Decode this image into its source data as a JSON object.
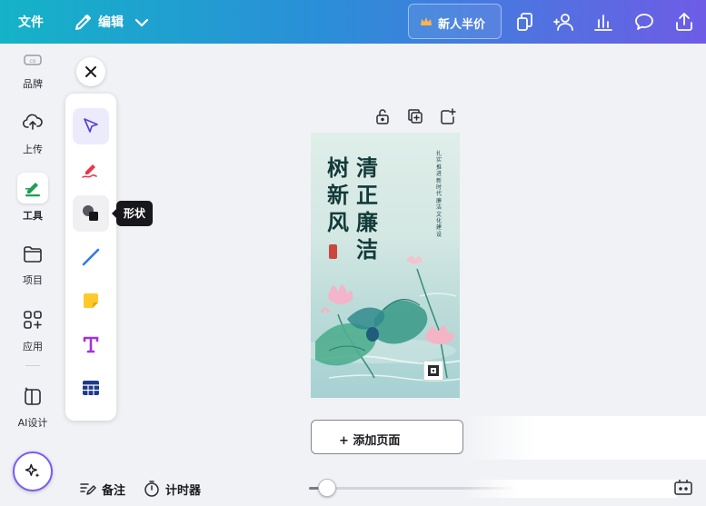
{
  "topbar": {
    "file_label": "文件",
    "edit_label": "编辑",
    "promo_label": "新人半价"
  },
  "rail": {
    "items": [
      {
        "label": "品牌",
        "icon": "brand-icon"
      },
      {
        "label": "上传",
        "icon": "cloud-upload-icon"
      },
      {
        "label": "工具",
        "icon": "tools-icon"
      },
      {
        "label": "项目",
        "icon": "folder-icon"
      },
      {
        "label": "应用",
        "icon": "apps-icon"
      },
      {
        "label": "AI设计",
        "icon": "ai-design-icon"
      }
    ]
  },
  "tools": {
    "items": [
      "select-tool",
      "pen-tool",
      "shape-tool",
      "line-tool",
      "sticky-note-tool",
      "text-tool",
      "table-tool"
    ],
    "tooltip": "形状"
  },
  "poster": {
    "title_col1": "清正廉洁",
    "title_col2": "树新风",
    "vertical_text": "扎实推进新时代廉洁文化建设"
  },
  "canvas": {
    "add_page_label": "+ 添加页面"
  },
  "bottom": {
    "notes_label": "备注",
    "timer_label": "计时器",
    "zoom_fraction": 0.08
  },
  "colors": {
    "accent": "#7a5af8",
    "topbar_start": "#14b3c7",
    "topbar_end": "#6e5ce6"
  }
}
